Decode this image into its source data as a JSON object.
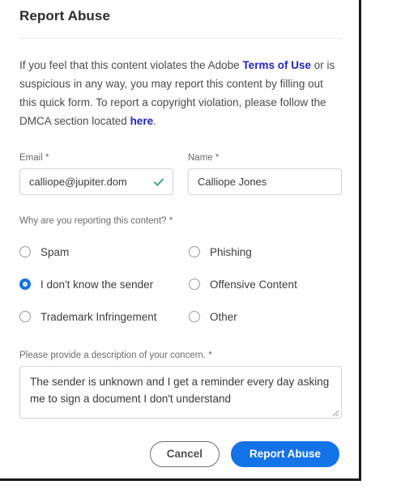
{
  "dialog": {
    "title": "Report Abuse",
    "intro": {
      "part1": "If you feel that this content violates the Adobe ",
      "link1": "Terms of Use",
      "part2": " or is suspicious in any way, you may report this content by filling out this quick form. To report a copyright violation, please follow the DMCA section located ",
      "link2": "here",
      "part3": "."
    },
    "email": {
      "label": "Email",
      "required_mark": "*",
      "value": "calliope@jupiter.dom",
      "placeholder": "Email",
      "valid_icon": "check-icon",
      "valid_color": "#2d9d78"
    },
    "name": {
      "label": "Name",
      "required_mark": "*",
      "value": "Calliope Jones",
      "placeholder": "Name"
    },
    "reason": {
      "label": "Why are you reporting this content?",
      "required_mark": "*",
      "selected": "I don't know the sender",
      "options": [
        {
          "label": "Spam",
          "selected": false
        },
        {
          "label": "Phishing",
          "selected": false
        },
        {
          "label": "I don't know the sender",
          "selected": true
        },
        {
          "label": "Offensive Content",
          "selected": false
        },
        {
          "label": "Trademark Infringement",
          "selected": false
        },
        {
          "label": "Other",
          "selected": false
        }
      ]
    },
    "description": {
      "label": "Please provide a description of your concern.",
      "required_mark": "*",
      "value": "The sender is unknown and I get a reminder every day asking me to sign a document I don't understand",
      "placeholder": "Please provide a description of your concern."
    },
    "actions": {
      "cancel_label": "Cancel",
      "submit_label": "Report Abuse"
    },
    "colors": {
      "accent_blue": "#1473e6",
      "link_blue": "#2323cc",
      "success_green": "#2d9d78",
      "border_gray": "#d3d3d3",
      "text_gray": "#6b6b6b"
    }
  }
}
